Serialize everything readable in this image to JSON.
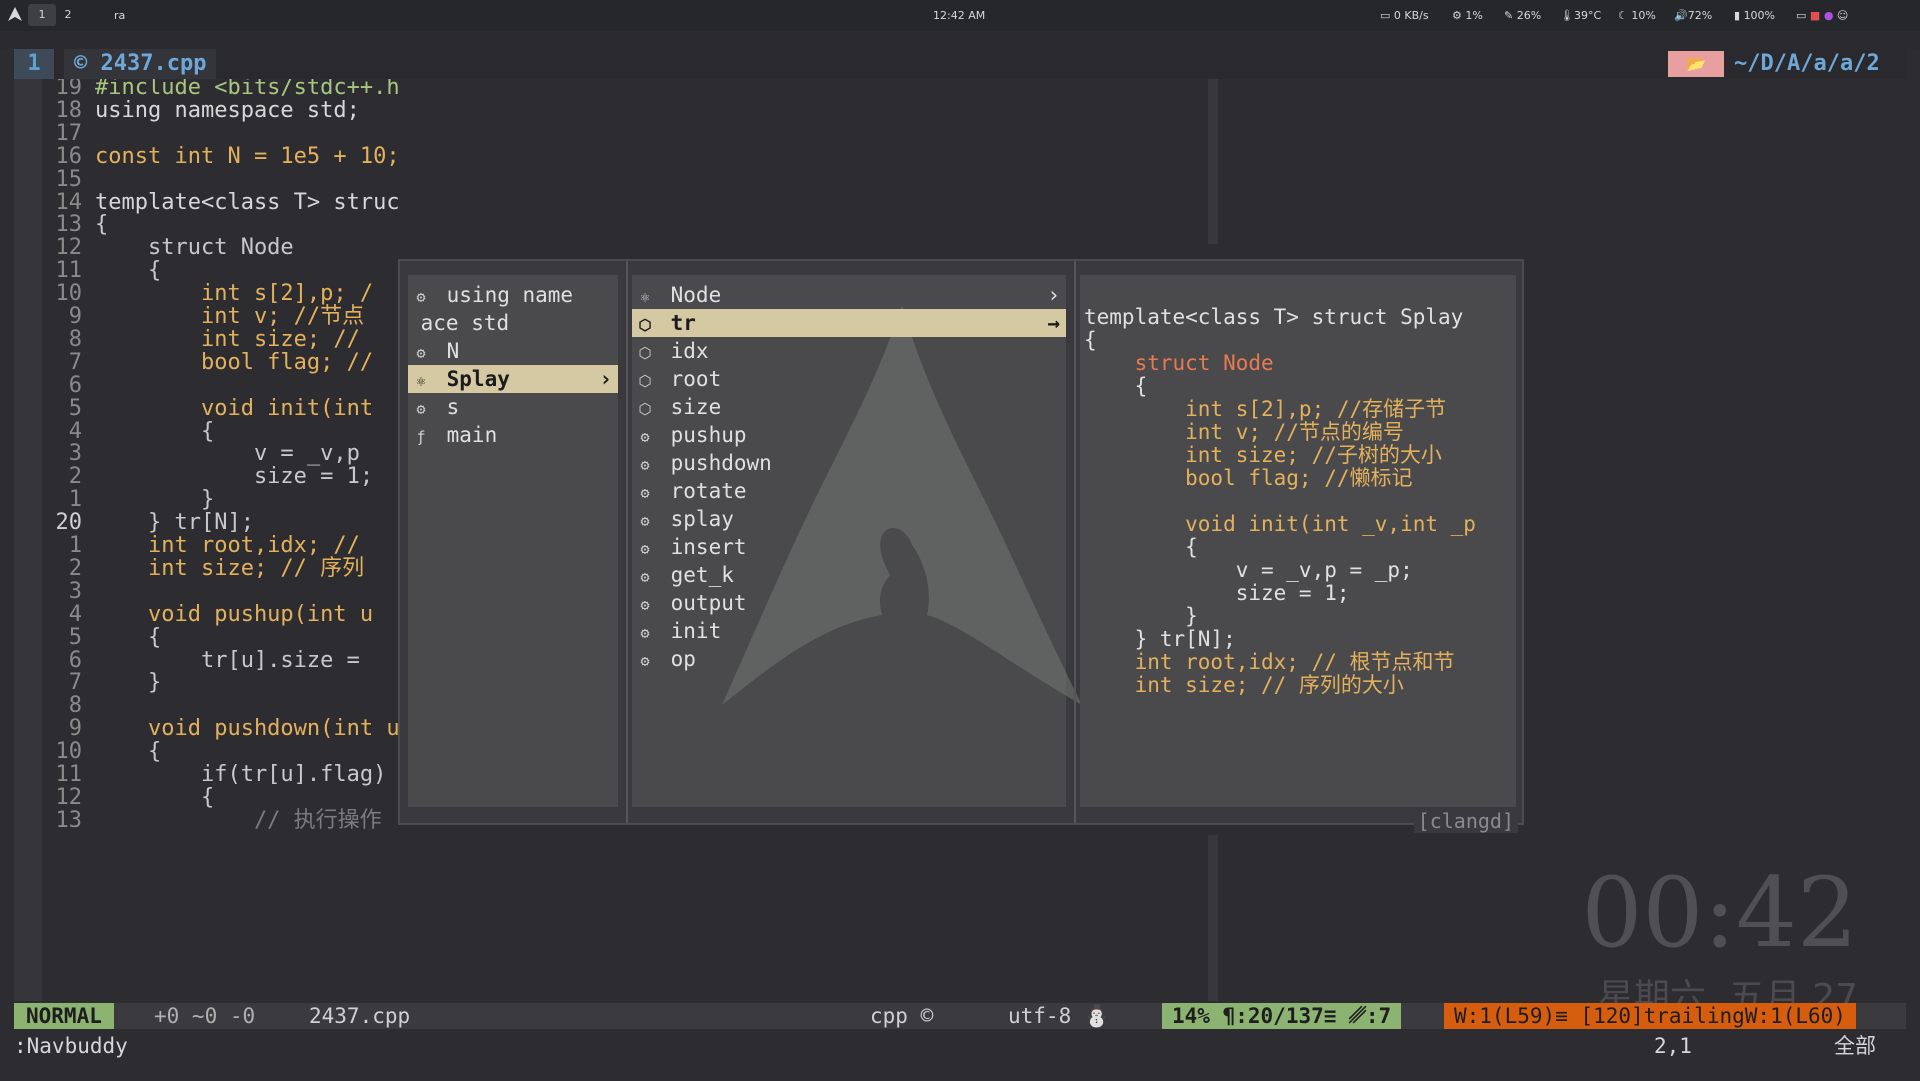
{
  "topbar": {
    "workspaces": [
      "1",
      "2"
    ],
    "app": "ra",
    "time": "12:42 AM",
    "net": "0 KB/s",
    "cpu": "1%",
    "mem": "26%",
    "temp": "39°C",
    "brightness": "10%",
    "volume": "72%",
    "battery": "100%"
  },
  "tab": {
    "index": "1",
    "filename": "2437.cpp",
    "path": "~/D/A/a/a/2"
  },
  "code": [
    {
      "n": "19",
      "t": "#include <bits/stdc++.h>"
    },
    {
      "n": "18",
      "t": "using namespace std;"
    },
    {
      "n": "17",
      "t": ""
    },
    {
      "n": "16",
      "t": "const int N = 1e5 + 10;"
    },
    {
      "n": "15",
      "t": ""
    },
    {
      "n": "14",
      "t": "template<class T> struct Splay"
    },
    {
      "n": "13",
      "t": "{"
    },
    {
      "n": "12",
      "t": "    struct Node"
    },
    {
      "n": "11",
      "t": "    {"
    },
    {
      "n": "10",
      "t": "        int s[2],p; /"
    },
    {
      "n": "9",
      "t": "        int v; //节点"
    },
    {
      "n": "8",
      "t": "        int size; //"
    },
    {
      "n": "7",
      "t": "        bool flag; //"
    },
    {
      "n": "6",
      "t": ""
    },
    {
      "n": "5",
      "t": "        void init(int"
    },
    {
      "n": "4",
      "t": "        {"
    },
    {
      "n": "3",
      "t": "            v = _v,p"
    },
    {
      "n": "2",
      "t": "            size = 1;"
    },
    {
      "n": "1",
      "t": "        }"
    },
    {
      "n": "20",
      "t": "    } tr[N];"
    },
    {
      "n": "1",
      "t": "    int root,idx; //"
    },
    {
      "n": "2",
      "t": "    int size; // 序列"
    },
    {
      "n": "3",
      "t": ""
    },
    {
      "n": "4",
      "t": "    void pushup(int u"
    },
    {
      "n": "5",
      "t": "    {"
    },
    {
      "n": "6",
      "t": "        tr[u].size ="
    },
    {
      "n": "7",
      "t": "    }"
    },
    {
      "n": "8",
      "t": ""
    },
    {
      "n": "9",
      "t": "    void pushdown(int u)"
    },
    {
      "n": "10",
      "t": "    {"
    },
    {
      "n": "11",
      "t": "        if(tr[u].flag)"
    },
    {
      "n": "12",
      "t": "        {"
    },
    {
      "n": "13",
      "t": "            // 执行操作"
    }
  ],
  "navbuddy": {
    "col1": [
      {
        "icon": "namespace-icon",
        "label": "using name"
      },
      {
        "icon": "",
        "label": "ace std"
      },
      {
        "icon": "namespace-icon",
        "label": "N"
      },
      {
        "icon": "struct-icon",
        "label": "Splay",
        "selected": true
      },
      {
        "icon": "namespace-icon",
        "label": "s"
      },
      {
        "icon": "function-icon",
        "label": "main"
      }
    ],
    "col2": [
      {
        "icon": "struct-icon",
        "label": "Node"
      },
      {
        "icon": "field-icon",
        "label": "tr",
        "selected": true
      },
      {
        "icon": "field-icon",
        "label": "idx"
      },
      {
        "icon": "field-icon",
        "label": "root"
      },
      {
        "icon": "field-icon",
        "label": "size"
      },
      {
        "icon": "method-icon",
        "label": "pushup"
      },
      {
        "icon": "method-icon",
        "label": "pushdown"
      },
      {
        "icon": "method-icon",
        "label": "rotate"
      },
      {
        "icon": "method-icon",
        "label": "splay"
      },
      {
        "icon": "method-icon",
        "label": "insert"
      },
      {
        "icon": "method-icon",
        "label": "get_k"
      },
      {
        "icon": "method-icon",
        "label": "output"
      },
      {
        "icon": "method-icon",
        "label": "init"
      },
      {
        "icon": "method-icon",
        "label": "op"
      }
    ],
    "preview": [
      "template<class T> struct Splay",
      "{",
      "    struct Node",
      "    {",
      "        int s[2],p; //存储子节",
      "        int v; //节点的编号",
      "        int size; //子树的大小",
      "        bool flag; //懒标记",
      "",
      "        void init(int _v,int _p",
      "        {",
      "            v = _v,p = _p;",
      "            size = 1;",
      "        }",
      "    } tr[N];",
      "    int root,idx; // 根节点和节",
      "    int size; // 序列的大小"
    ],
    "footer": "[clangd]"
  },
  "statusline": {
    "mode": "NORMAL",
    "diff": "+0 ~0 -0",
    "file": "2437.cpp",
    "filetype": "cpp",
    "encoding": "utf-8",
    "percent": "14%",
    "position": ":20/137≡",
    "col": ":7",
    "warnings": "W:1(L59)≡ [120]trailingW:1(L60)"
  },
  "cmdline": {
    "text": ":Navbuddy",
    "pos": "2,1",
    "all": "全部"
  },
  "clock": {
    "time": "00:42",
    "date": "星期六, 五月 27"
  },
  "colors": {
    "accent": "#e3b15c",
    "mode_bg": "#8cb371",
    "warn_bg": "#d65d0e",
    "tab_num": "#5fa0d0"
  }
}
